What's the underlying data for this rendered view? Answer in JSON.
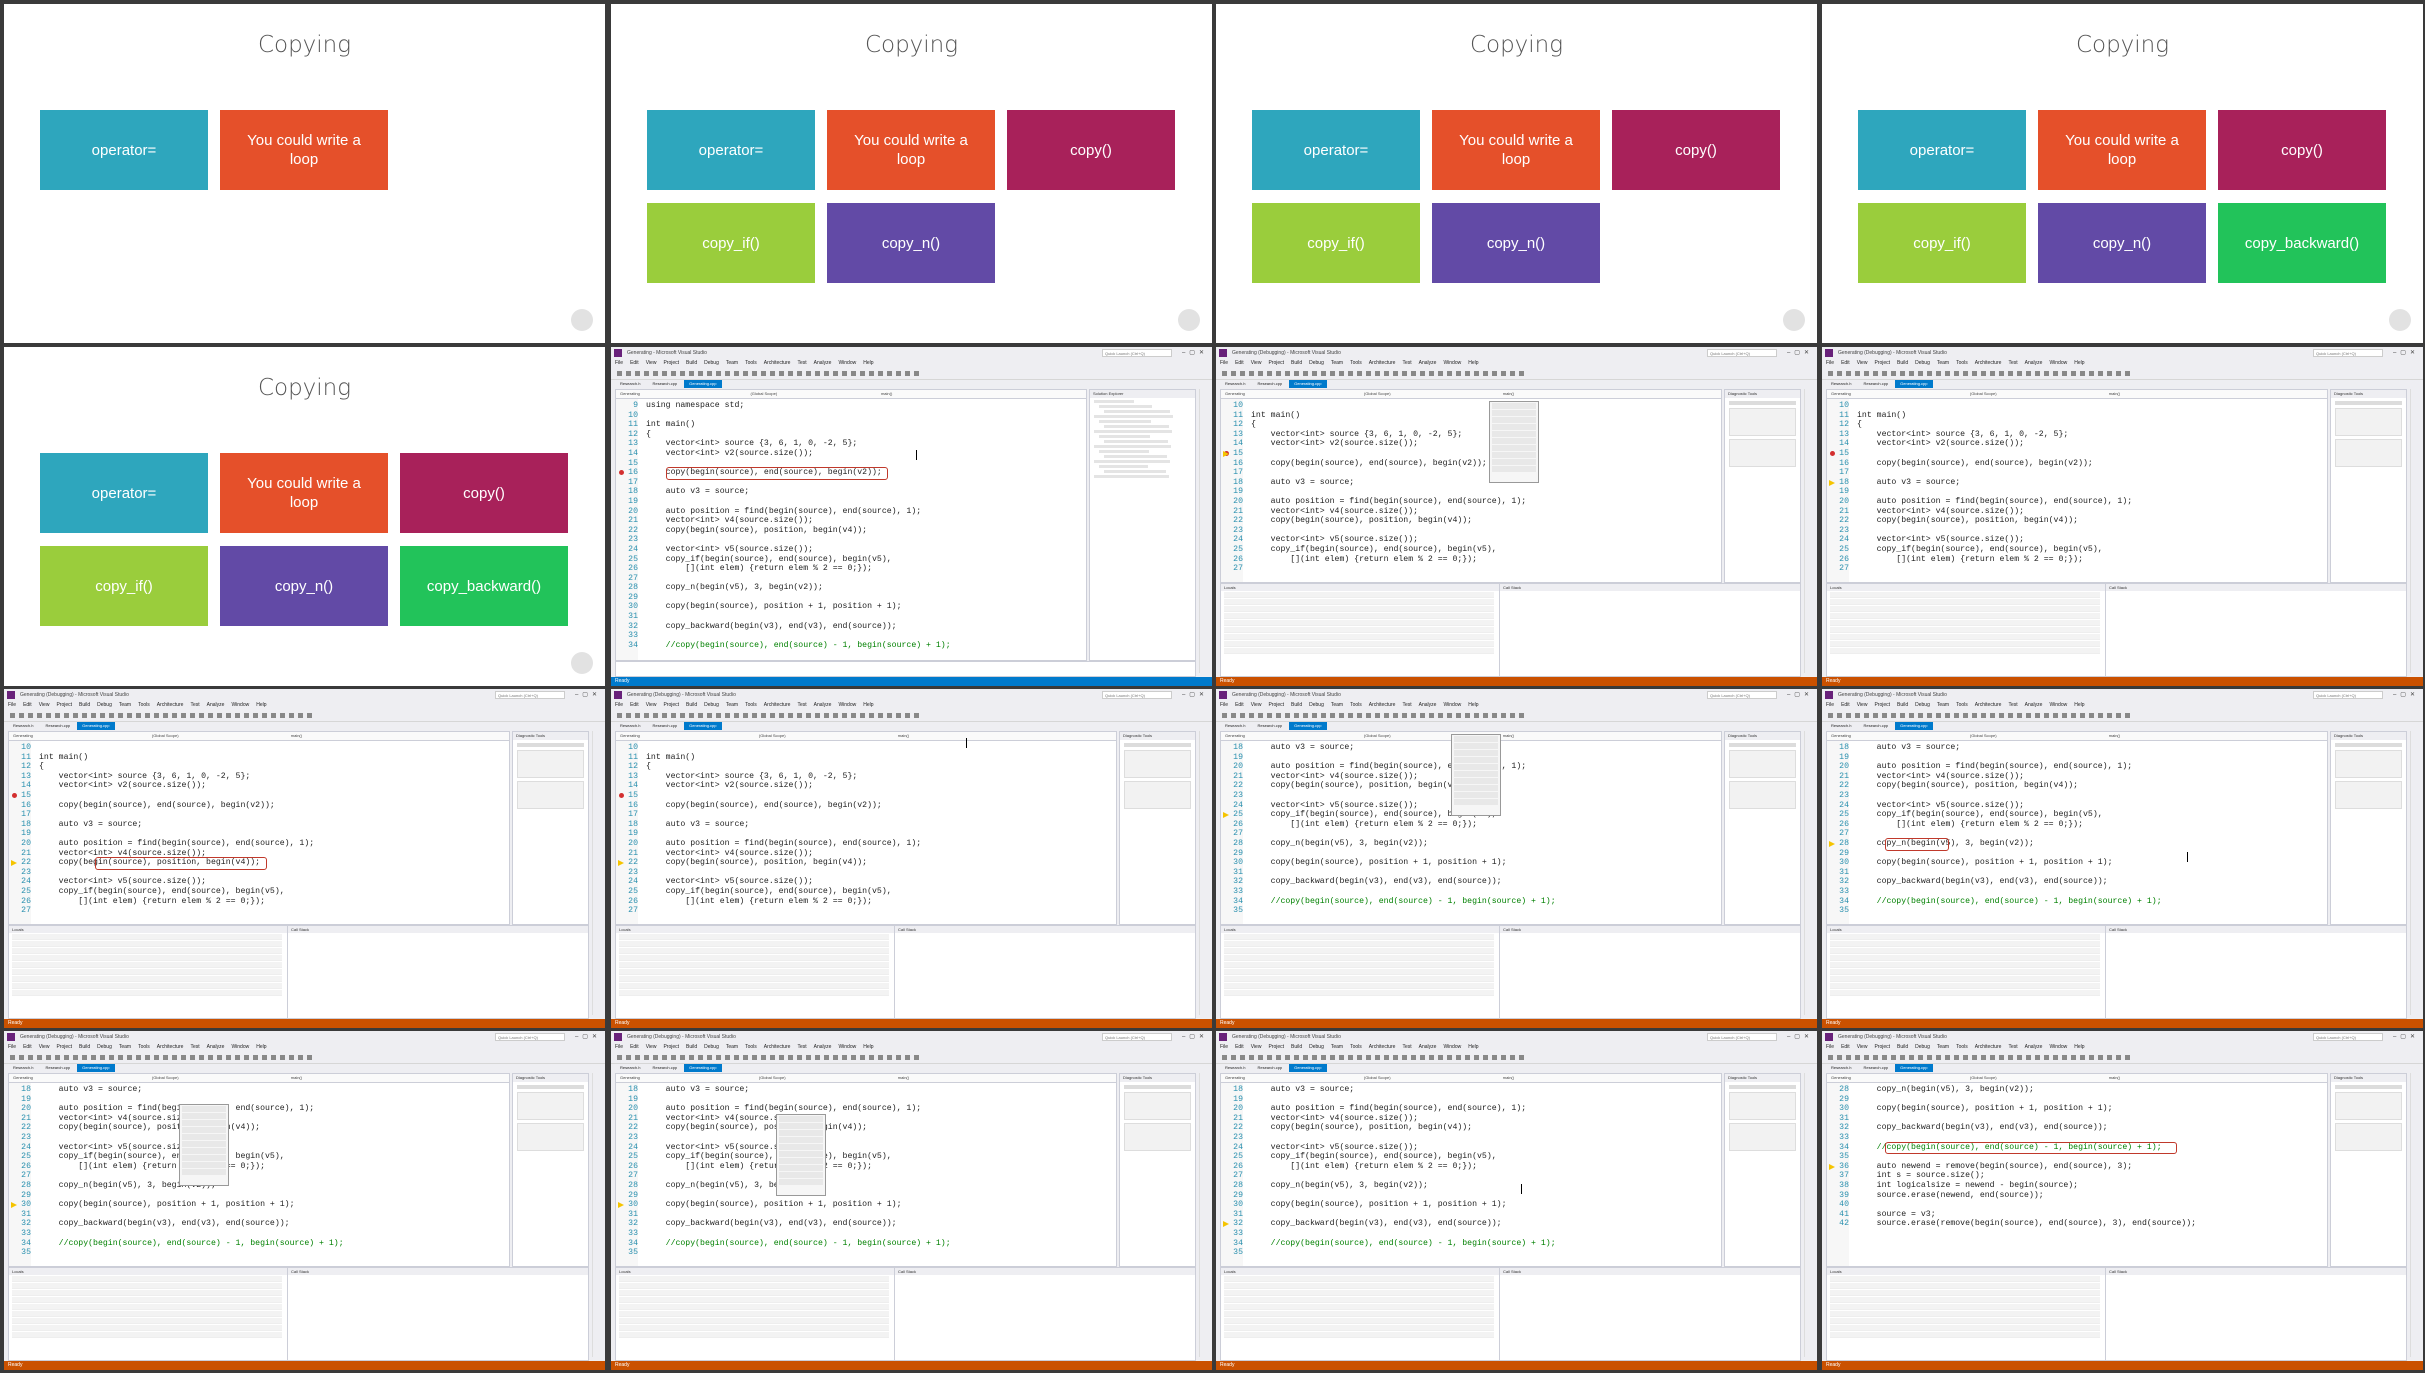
{
  "slides": {
    "title": "Copying",
    "boxes": [
      {
        "label": "operator=",
        "color": "#2ea6bd"
      },
      {
        "label": "You could write a loop",
        "color": "#e5502a"
      },
      {
        "label": "copy()",
        "color": "#a8215a"
      },
      {
        "label": "copy_if()",
        "color": "#9acd3c"
      },
      {
        "label": "copy_n()",
        "color": "#624aa6"
      },
      {
        "label": "copy_backward()",
        "color": "#22c35a"
      }
    ]
  },
  "ide": {
    "title_design": "Generating - Microsoft Visual Studio",
    "title_debug": "Generating (Debugging) - Microsoft Visual Studio",
    "quick_launch": "Quick Launch (Ctrl+Q)",
    "user": "Kate Gregory",
    "menu": [
      "File",
      "Edit",
      "View",
      "Project",
      "Build",
      "Debug",
      "Team",
      "Tools",
      "Architecture",
      "Test",
      "Analyze",
      "Window",
      "Help"
    ],
    "tabs": [
      "Research.h",
      "Research.cpp",
      "Generating.cpp"
    ],
    "nav": [
      "Generating",
      "(Global Scope)",
      "main()"
    ],
    "solution_explorer": "Solution Explorer",
    "diagnostic_tools": "Diagnostic Tools",
    "locals": "Locals",
    "call_stack": "Call Stack",
    "status_ready": "Ready",
    "code": [
      {
        "n": "9",
        "t": "using namespace std;"
      },
      {
        "n": "10",
        "t": ""
      },
      {
        "n": "11",
        "t": "int main()"
      },
      {
        "n": "12",
        "t": "{"
      },
      {
        "n": "13",
        "t": "    vector<int> source {3, 6, 1, 0, -2, 5};"
      },
      {
        "n": "14",
        "t": "    vector<int> v2(source.size());"
      },
      {
        "n": "15",
        "t": ""
      },
      {
        "n": "16",
        "t": "    copy(begin(source), end(source), begin(v2));"
      },
      {
        "n": "17",
        "t": ""
      },
      {
        "n": "18",
        "t": "    auto v3 = source;"
      },
      {
        "n": "19",
        "t": ""
      },
      {
        "n": "20",
        "t": "    auto position = find(begin(source), end(source), 1);"
      },
      {
        "n": "21",
        "t": "    vector<int> v4(source.size());"
      },
      {
        "n": "22",
        "t": "    copy(begin(source), position, begin(v4));"
      },
      {
        "n": "23",
        "t": ""
      },
      {
        "n": "24",
        "t": "    vector<int> v5(source.size());"
      },
      {
        "n": "25",
        "t": "    copy_if(begin(source), end(source), begin(v5),"
      },
      {
        "n": "26",
        "t": "        [](int elem) {return elem % 2 == 0;});"
      },
      {
        "n": "27",
        "t": ""
      },
      {
        "n": "28",
        "t": "    copy_n(begin(v5), 3, begin(v2));"
      },
      {
        "n": "29",
        "t": ""
      },
      {
        "n": "30",
        "t": "    copy(begin(source), position + 1, position + 1);"
      },
      {
        "n": "31",
        "t": ""
      },
      {
        "n": "32",
        "t": "    copy_backward(begin(v3), end(v3), end(source));"
      },
      {
        "n": "33",
        "t": ""
      },
      {
        "n": "34",
        "t": "    //copy(begin(source), end(source) - 1, begin(source) + 1);"
      },
      {
        "n": "35",
        "t": ""
      },
      {
        "n": "36",
        "t": "    auto newend = remove(begin(source), end(source), 3);"
      },
      {
        "n": "37",
        "t": "    int s = source.size();"
      },
      {
        "n": "38",
        "t": "    int logicalsize = newend - begin(source);"
      },
      {
        "n": "39",
        "t": "    source.erase(newend, end(source));"
      },
      {
        "n": "40",
        "t": ""
      },
      {
        "n": "41",
        "t": "    source = v3;"
      },
      {
        "n": "42",
        "t": "    source.erase(remove(begin(source), end(source), 3), end(source));"
      }
    ]
  }
}
